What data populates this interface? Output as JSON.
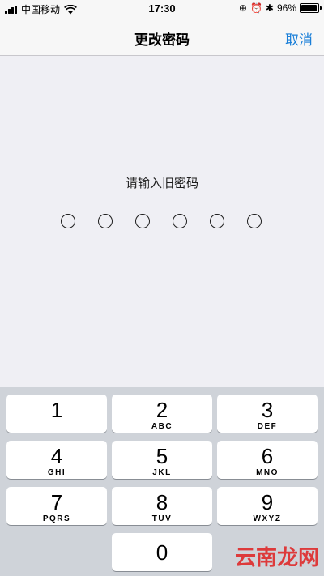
{
  "status_bar": {
    "carrier": "中国移动",
    "time": "17:30",
    "battery_percent": "96%",
    "battery_level": 0.96
  },
  "nav": {
    "title": "更改密码",
    "cancel_label": "取消"
  },
  "prompt": "请输入旧密码",
  "passcode_length": 6,
  "keypad": [
    {
      "num": "1",
      "letters": ""
    },
    {
      "num": "2",
      "letters": "ABC"
    },
    {
      "num": "3",
      "letters": "DEF"
    },
    {
      "num": "4",
      "letters": "GHI"
    },
    {
      "num": "5",
      "letters": "JKL"
    },
    {
      "num": "6",
      "letters": "MNO"
    },
    {
      "num": "7",
      "letters": "PQRS"
    },
    {
      "num": "8",
      "letters": "TUV"
    },
    {
      "num": "9",
      "letters": "WXYZ"
    },
    {
      "num": "0",
      "letters": ""
    }
  ],
  "watermark": "云南龙网",
  "colors": {
    "accent": "#1a7fd8",
    "background": "#efeff4",
    "keypad_bg": "#cfd3d9"
  }
}
